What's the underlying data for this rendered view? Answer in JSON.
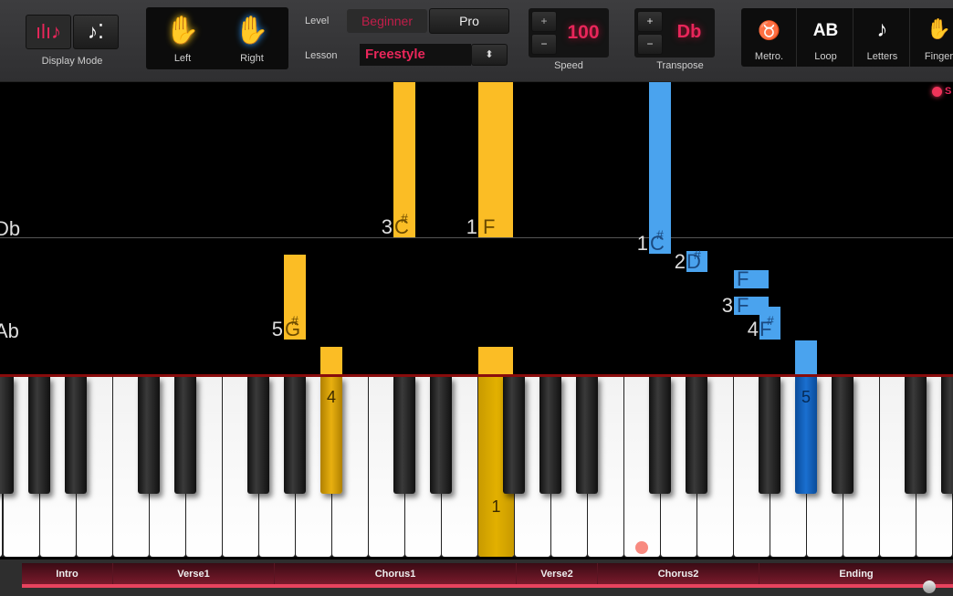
{
  "toolbar": {
    "display_mode": {
      "label": "Display Mode",
      "options": [
        "falling-notes-icon",
        "sheet-notes-icon"
      ],
      "selected": 0
    },
    "hands": {
      "left": "Left",
      "right": "Right",
      "left_color": "#f5c518",
      "right_color": "#2e9bff"
    },
    "level": {
      "label": "Level",
      "options": [
        "Beginner",
        "Pro"
      ],
      "selected": "Beginner"
    },
    "lesson": {
      "label": "Lesson",
      "value": "Freestyle"
    },
    "speed": {
      "label": "Speed",
      "value": "100",
      "plus": "+",
      "minus": "−"
    },
    "transpose": {
      "label": "Transpose",
      "value": "Db",
      "plus": "+",
      "minus": "−"
    },
    "tools": [
      {
        "label": "Metro.",
        "icon": "metronome-icon"
      },
      {
        "label": "Loop",
        "icon_text": "AB"
      },
      {
        "label": "Letters",
        "icon_text": "♪"
      },
      {
        "label": "Finger",
        "icon": "finger-hand-icon"
      }
    ]
  },
  "record": {
    "label": "S"
  },
  "roll": {
    "row_labels": [
      "Db",
      "Ab"
    ],
    "notes": [
      {
        "hand": "left",
        "note": "C",
        "sharp": "#",
        "finger": "3"
      },
      {
        "hand": "left",
        "note": "F",
        "sharp": "",
        "finger": "1"
      },
      {
        "hand": "left",
        "note": "G",
        "sharp": "#",
        "finger": "5"
      },
      {
        "hand": "right",
        "note": "C",
        "sharp": "#",
        "finger": "1"
      },
      {
        "hand": "right",
        "note": "D",
        "sharp": "#",
        "finger": "2"
      },
      {
        "hand": "right",
        "note": "F",
        "sharp": "",
        "finger": ""
      },
      {
        "hand": "right",
        "note": "F",
        "sharp": "",
        "finger": "3"
      },
      {
        "hand": "right",
        "note": "F",
        "sharp": "#",
        "finger": "4"
      }
    ]
  },
  "keyboard": {
    "pressed": [
      {
        "finger": "4",
        "hand": "left"
      },
      {
        "finger": "1",
        "hand": "left"
      },
      {
        "finger": "5",
        "hand": "right"
      }
    ]
  },
  "sections": [
    "Intro",
    "Verse1",
    "Chorus1",
    "Verse2",
    "Chorus2",
    "Ending"
  ],
  "colors": {
    "accent": "#e8265a",
    "left": "#fbbd25",
    "right": "#4aa3ee"
  }
}
